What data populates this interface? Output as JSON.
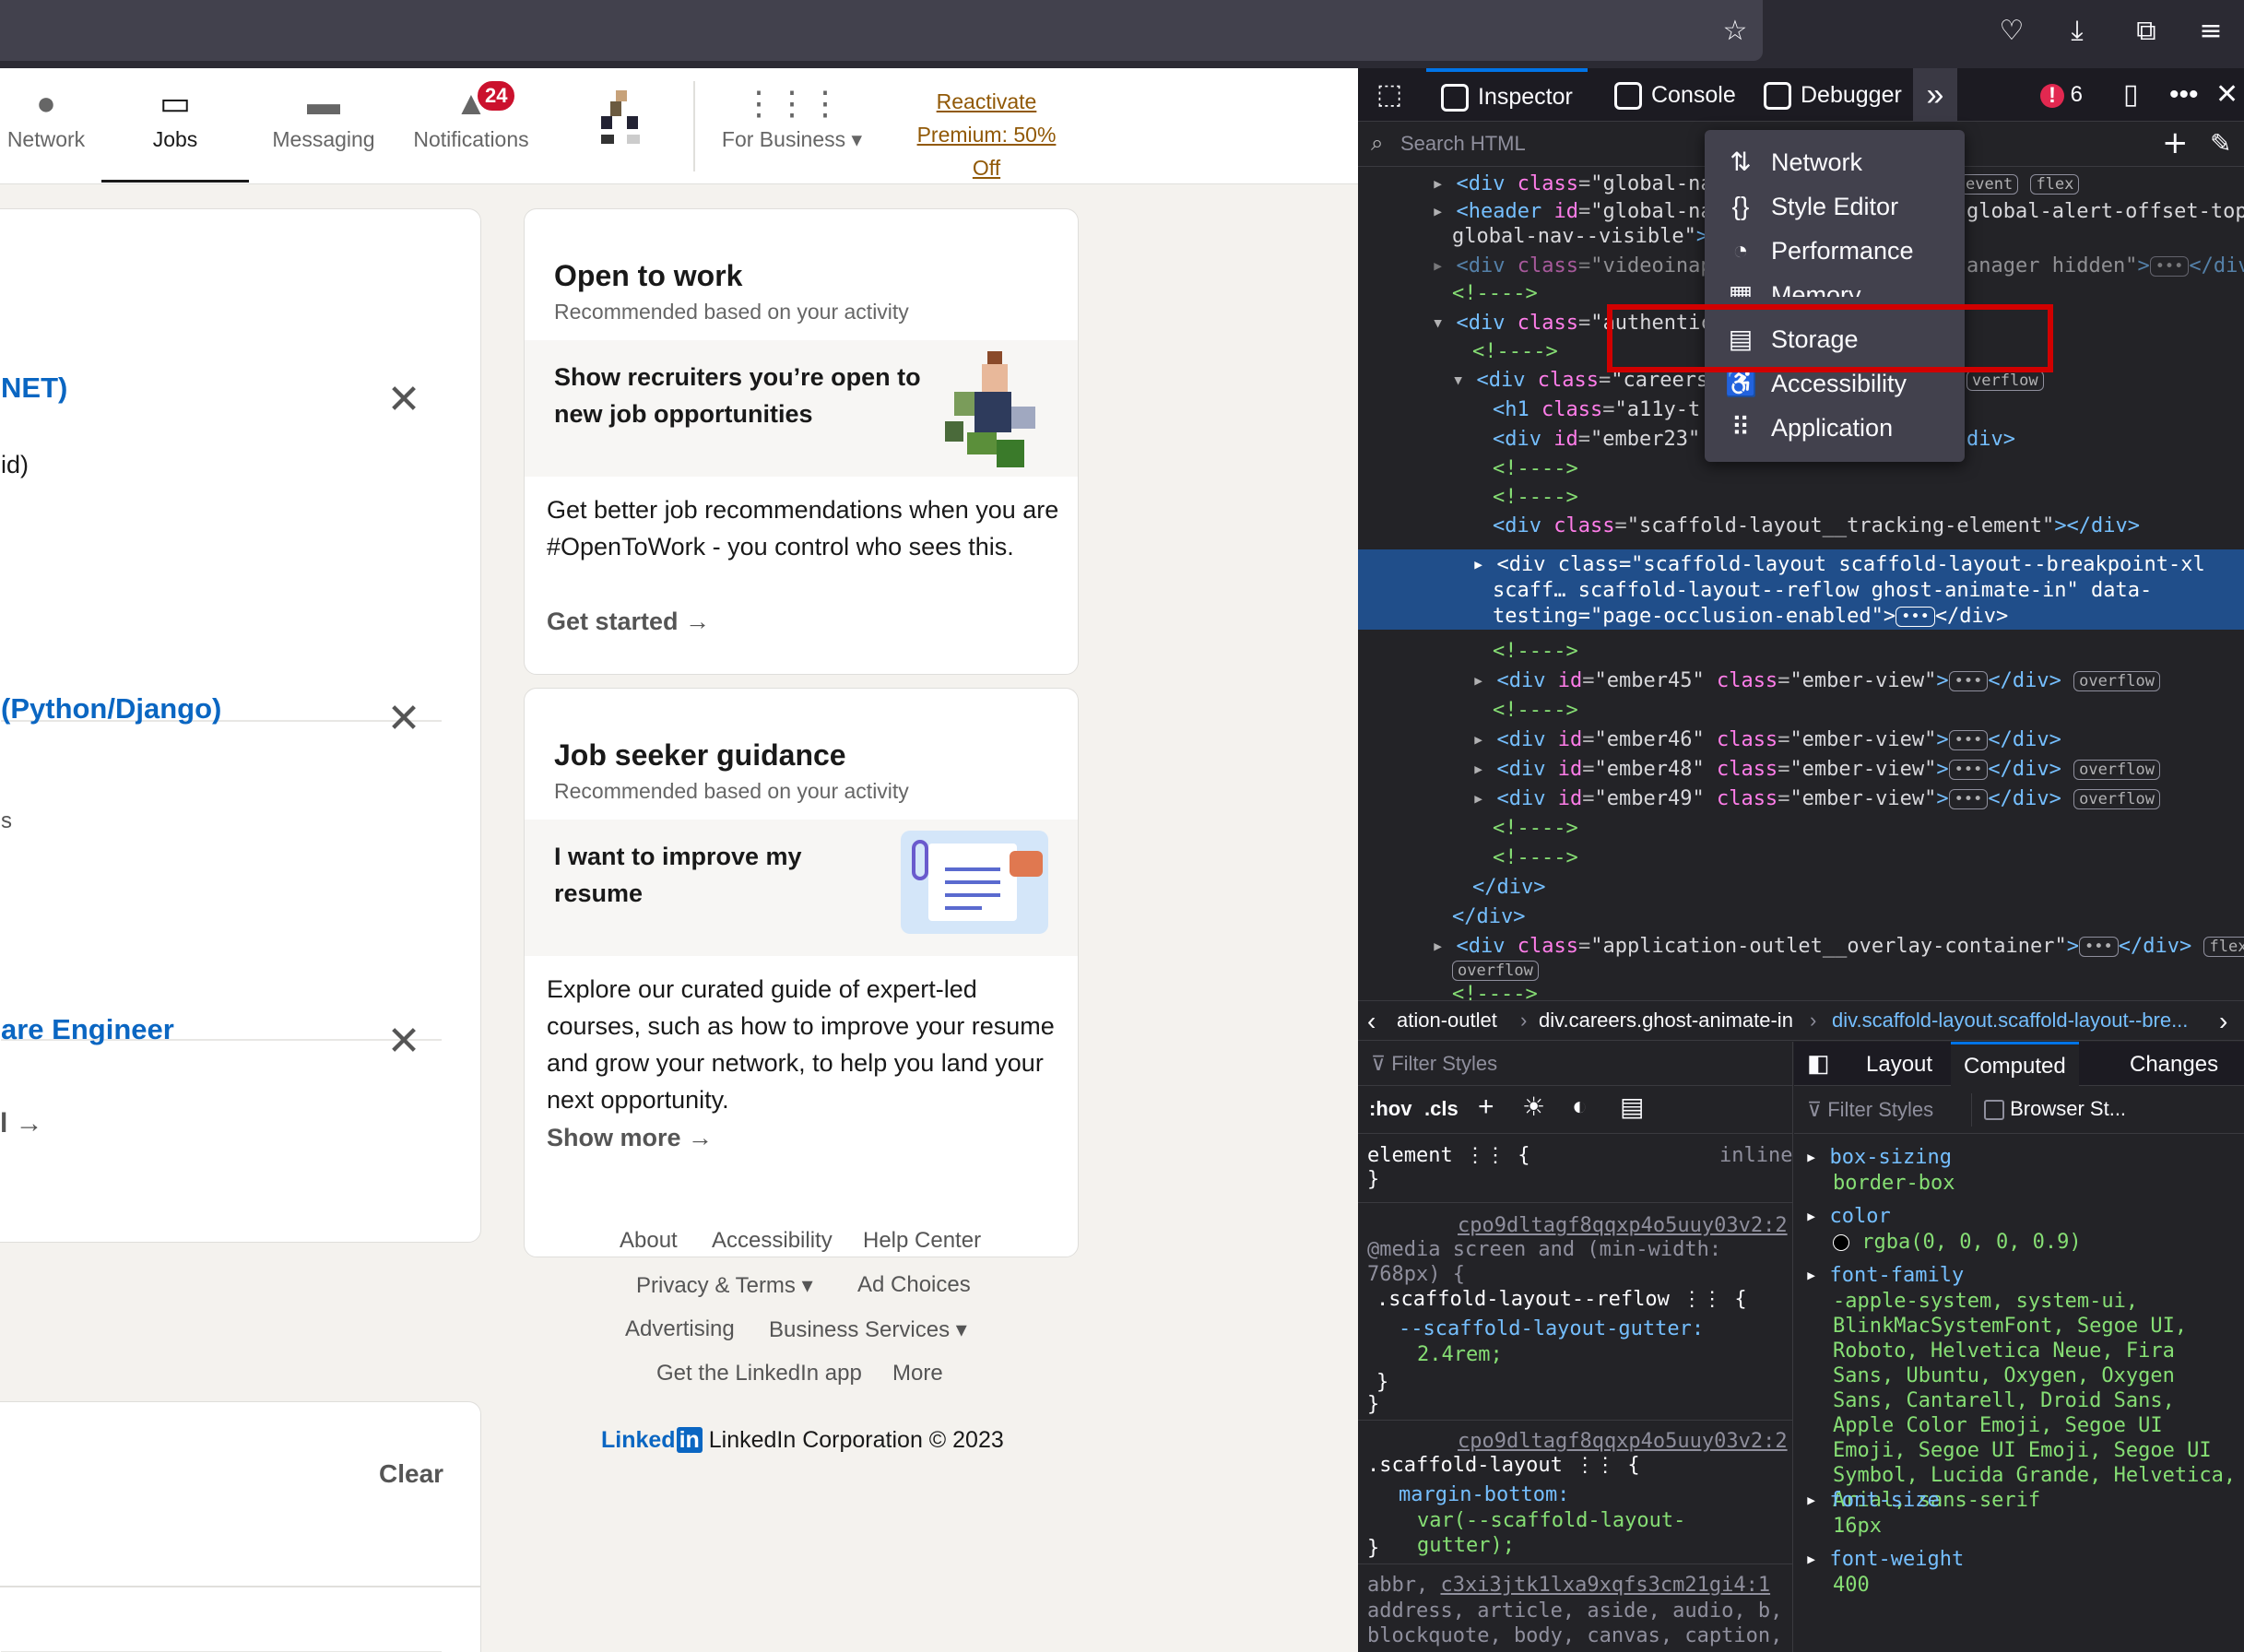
{
  "browser": {
    "icons": [
      "bookmark-star-icon",
      "pocket-icon",
      "download-icon",
      "extensions-icon",
      "menu-icon"
    ]
  },
  "linkedin": {
    "nav": [
      {
        "label": "Network",
        "icon": "network-icon"
      },
      {
        "label": "Jobs",
        "icon": "jobs-icon",
        "active": true
      },
      {
        "label": "Messaging",
        "icon": "messaging-icon"
      },
      {
        "label": "Notifications",
        "icon": "notifications-icon",
        "badge": "24"
      },
      {
        "label": "For Business",
        "icon": "grid-icon"
      }
    ],
    "premium": {
      "line1": "Reactivate",
      "line2": "Premium: 50%",
      "line3": "Off"
    },
    "jobs": [
      {
        "title": "NET)",
        "sub": "id)"
      },
      {
        "title": "(Python/Django)",
        "sub": "s"
      },
      {
        "title": "are Engineer",
        "sub": ""
      }
    ],
    "see_all": "l",
    "clear": "Clear",
    "open_to_work": {
      "title": "Open to work",
      "sub": "Recommended based on your activity",
      "promo": "Show recruiters you’re open to new job opportunities",
      "body": "Get better job recommendations when you are #OpenToWork - you control who sees this.",
      "cta": "Get started"
    },
    "guidance": {
      "title": "Job seeker guidance",
      "sub": "Recommended based on your activity",
      "promo": "I want to improve my resume",
      "body": "Explore our curated guide of expert-led courses, such as how to improve your resume and grow your network, to help you land your next opportunity.",
      "cta": "Show more"
    },
    "footer": {
      "links": [
        "About",
        "Accessibility",
        "Help Center",
        "Privacy & Terms",
        "Ad Choices",
        "Advertising",
        "Business Services",
        "Get the LinkedIn app",
        "More"
      ],
      "logo": "Linked",
      "copyright": "LinkedIn Corporation © 2023"
    }
  },
  "devtools": {
    "tabs": [
      "Inspector",
      "Console",
      "Debugger"
    ],
    "error_count": "6",
    "search_placeholder": "Search HTML",
    "menu": [
      "Network",
      "Style Editor",
      "Performance",
      "Memory",
      "Storage",
      "Accessibility",
      "Application"
    ],
    "breadcrumb": [
      "ation-outlet",
      "div.careers.ghost-animate-in",
      "div.scaffold-layout.scaffold-layout--bre..."
    ],
    "styles": {
      "filter_placeholder": "Filter Styles",
      "hov": ":hov",
      "cls": ".cls",
      "element": "element",
      "inline": "inline",
      "source1": "cpo9dltagf8qqxp4o5uuy03v2:2",
      "media": "@media screen and (min-width: 768px) {",
      "rule1_sel": ".scaffold-layout--reflow",
      "rule1_prop": "--scaffold-layout-gutter:",
      "rule1_val": "2.4rem;",
      "source2": "cpo9dltagf8qqxp4o5uuy03v2:2",
      "rule2_sel": ".scaffold-layout",
      "rule2_prop": "margin-bottom:",
      "rule2_val": "var(--scaffold-layout-gutter);",
      "source3": "c3xi3jtk1lxa9xqfs3cm21gi4:1",
      "rule3": "address, article, aside, audio, b, blockquote, body, canvas, caption,"
    },
    "computed": {
      "tabs": [
        "Layout",
        "Computed",
        "Changes"
      ],
      "filter_placeholder": "Filter Styles",
      "browser_styles": "Browser St...",
      "props": [
        {
          "name": "box-sizing",
          "value": "border-box"
        },
        {
          "name": "color",
          "value": "rgba(0, 0, 0, 0.9)"
        },
        {
          "name": "font-family",
          "value": "-apple-system, system-ui, BlinkMacSystemFont, Segoe UI, Roboto, Helvetica Neue, Fira Sans, Ubuntu, Oxygen, Oxygen Sans, Cantarell, Droid Sans, Apple Color Emoji, Segoe UI Emoji, Segoe UI Emoji, Segoe UI Symbol, Lucida Grande, Helvetica, Arial, sans-serif"
        },
        {
          "name": "font-size",
          "value": "16px"
        },
        {
          "name": "font-weight",
          "value": "400"
        }
      ]
    }
  }
}
